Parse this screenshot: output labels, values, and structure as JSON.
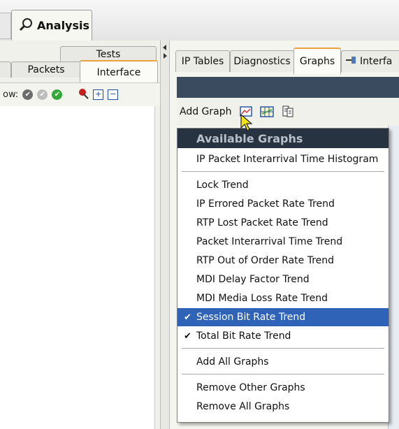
{
  "top": {
    "analysis_tab": "Analysis"
  },
  "left": {
    "tabs_row1": [
      "Tests"
    ],
    "tabs_row2": [
      "Packets",
      "Interface"
    ],
    "toolbar_label": "ow:"
  },
  "right": {
    "tabs": [
      "IP Tables",
      "Diagnostics",
      "Graphs",
      "Interfa"
    ],
    "add_graph_label": "Add Graph"
  },
  "menu": {
    "header": "Available Graphs",
    "group1": [
      {
        "label": "IP Packet Interarrival Time Histogram",
        "checked": false,
        "selected": false
      }
    ],
    "group2": [
      {
        "label": "Lock Trend",
        "checked": false,
        "selected": false
      },
      {
        "label": "IP Errored Packet Rate Trend",
        "checked": false,
        "selected": false
      },
      {
        "label": "RTP Lost Packet Rate Trend",
        "checked": false,
        "selected": false
      },
      {
        "label": "Packet Interarrival Time Trend",
        "checked": false,
        "selected": false
      },
      {
        "label": "RTP Out of Order Rate Trend",
        "checked": false,
        "selected": false
      },
      {
        "label": "MDI Delay Factor Trend",
        "checked": false,
        "selected": false
      },
      {
        "label": "MDI Media Loss Rate Trend",
        "checked": false,
        "selected": false
      },
      {
        "label": "Session Bit Rate Trend",
        "checked": true,
        "selected": true
      },
      {
        "label": "Total Bit Rate Trend",
        "checked": true,
        "selected": false
      }
    ],
    "add_all": "Add All Graphs",
    "remove_other": "Remove Other Graphs",
    "remove_all": "Remove All Graphs",
    "check_glyph": "✔"
  },
  "colors": {
    "menu_header_bg": "#283341",
    "selection": "#2f63b8",
    "graph_header": "#3a4a5f"
  }
}
